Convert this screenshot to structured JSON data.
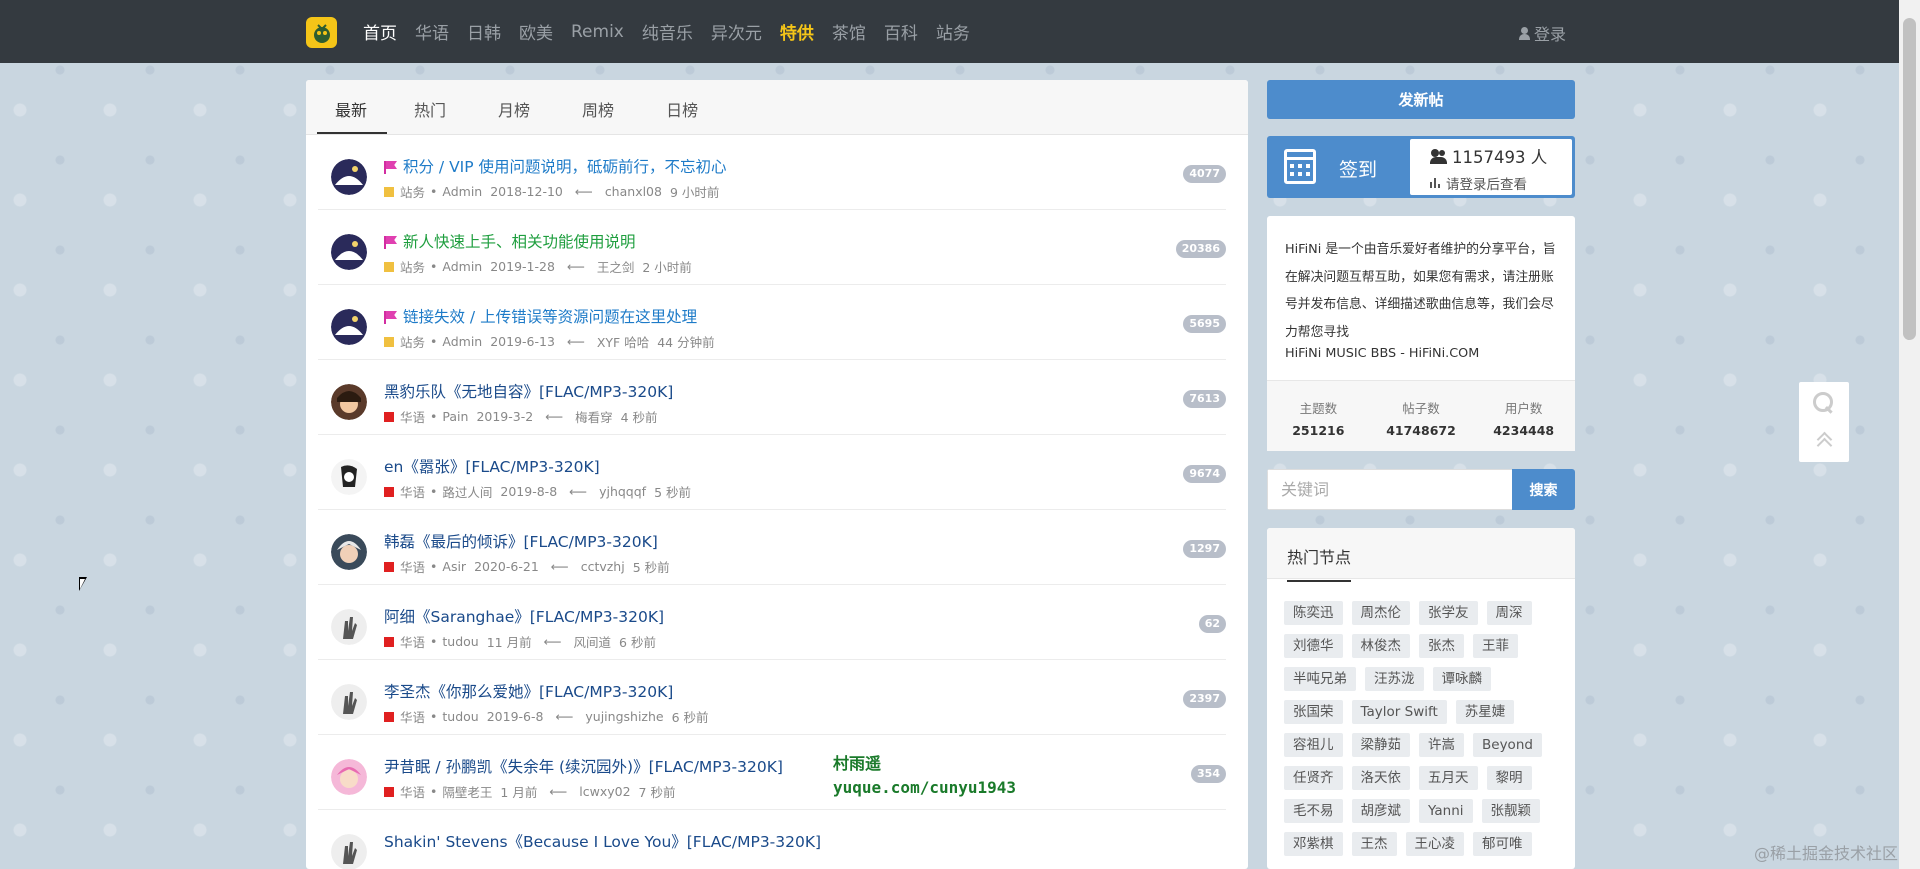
{
  "nav": {
    "logo": "logo",
    "items": [
      {
        "label": "首页",
        "state": "active"
      },
      {
        "label": "华语",
        "state": ""
      },
      {
        "label": "日韩",
        "state": ""
      },
      {
        "label": "欧美",
        "state": ""
      },
      {
        "label": "Remix",
        "state": ""
      },
      {
        "label": "纯音乐",
        "state": ""
      },
      {
        "label": "异次元",
        "state": ""
      },
      {
        "label": "特供",
        "state": "special"
      },
      {
        "label": "茶馆",
        "state": ""
      },
      {
        "label": "百科",
        "state": ""
      },
      {
        "label": "站务",
        "state": ""
      }
    ],
    "login": "登录"
  },
  "tabs": [
    "最新",
    "热门",
    "月榜",
    "周榜",
    "日榜"
  ],
  "threads": [
    {
      "title": "积分 / VIP 使用问题说明，砥砺前行，不忘初心",
      "pinned": true,
      "title_color": "blue",
      "category": "站务",
      "cat_color": "#f0c040",
      "author": "Admin",
      "date": "2018-12-10",
      "last_user": "chanxl08",
      "last_time": "9 小时前",
      "count": "4077",
      "avatar": "space"
    },
    {
      "title": "新人快速上手、相关功能使用说明",
      "pinned": true,
      "title_color": "green",
      "category": "站务",
      "cat_color": "#f0c040",
      "author": "Admin",
      "date": "2019-1-28",
      "last_user": "王之剑",
      "last_time": "2 小时前",
      "count": "20386",
      "avatar": "space"
    },
    {
      "title": "链接失效 / 上传错误等资源问题在这里处理",
      "pinned": true,
      "title_color": "blue",
      "category": "站务",
      "cat_color": "#f0c040",
      "author": "Admin",
      "date": "2019-6-13",
      "last_user": "XYF 哈哈",
      "last_time": "44 分钟前",
      "count": "5695",
      "avatar": "space"
    },
    {
      "title": "黑豹乐队《无地自容》[FLAC/MP3-320K]",
      "pinned": false,
      "title_color": "normal",
      "category": "华语",
      "cat_color": "#e02020",
      "author": "Pain",
      "date": "2019-3-2",
      "last_user": "梅看穿",
      "last_time": "4 秒前",
      "count": "7613",
      "avatar": "anime"
    },
    {
      "title": "en《嚣张》[FLAC/MP3-320K]",
      "pinned": false,
      "title_color": "normal",
      "category": "华语",
      "cat_color": "#e02020",
      "author": "路过人间",
      "date": "2019-8-8",
      "last_user": "yjhqqqf",
      "last_time": "5 秒前",
      "count": "9674",
      "avatar": "sketch"
    },
    {
      "title": "韩磊《最后的倾诉》[FLAC/MP3-320K]",
      "pinned": false,
      "title_color": "normal",
      "category": "华语",
      "cat_color": "#e02020",
      "author": "Asir",
      "date": "2020-6-21",
      "last_user": "cctvzhj",
      "last_time": "5 秒前",
      "count": "1297",
      "avatar": "silver"
    },
    {
      "title": "阿细《Saranghae》[FLAC/MP3-320K]",
      "pinned": false,
      "title_color": "normal",
      "category": "华语",
      "cat_color": "#e02020",
      "author": "tudou",
      "date": "11 月前",
      "last_user": "风间道",
      "last_time": "6 秒前",
      "count": "62",
      "avatar": "hand"
    },
    {
      "title": "李圣杰《你那么爱她》[FLAC/MP3-320K]",
      "pinned": false,
      "title_color": "normal",
      "category": "华语",
      "cat_color": "#e02020",
      "author": "tudou",
      "date": "2019-6-8",
      "last_user": "yujingshizhe",
      "last_time": "6 秒前",
      "count": "2397",
      "avatar": "hand"
    },
    {
      "title": "尹昔眠 / 孙鹏凯《失余年 (续沉园外)》[FLAC/MP3-320K]",
      "pinned": false,
      "title_color": "normal",
      "category": "华语",
      "cat_color": "#e02020",
      "author": "隔壁老王",
      "date": "1 月前",
      "last_user": "lcwxy02",
      "last_time": "7 秒前",
      "count": "354",
      "avatar": "pink"
    },
    {
      "title": "Shakin' Stevens《Because I Love You》[FLAC/MP3-320K]",
      "pinned": false,
      "title_color": "normal",
      "category": "",
      "cat_color": "#e02020",
      "author": "",
      "date": "",
      "last_user": "",
      "last_time": "",
      "count": "",
      "avatar": "hand"
    }
  ],
  "sidebar": {
    "post_button": "发新帖",
    "checkin_label": "签到",
    "checkin_count": "1157493 人",
    "checkin_login": "请登录后查看",
    "about_text": "HiFiNi 是一个由音乐爱好者维护的分享平台，旨在解决问题互帮互助，如果您有需求，请注册账号并发布信息、详细描述歌曲信息等，我们会尽力帮您寻找",
    "about_site": "HiFiNi MUSIC BBS - HiFiNi.COM",
    "stats": [
      {
        "label": "主题数",
        "value": "251216"
      },
      {
        "label": "帖子数",
        "value": "41748672"
      },
      {
        "label": "用户数",
        "value": "4234448"
      }
    ],
    "search_placeholder": "关键词",
    "search_button": "搜索",
    "hot_title": "热门节点",
    "hot_tags": [
      "陈奕迅",
      "周杰伦",
      "张学友",
      "周深",
      "刘德华",
      "林俊杰",
      "张杰",
      "王菲",
      "半吨兄弟",
      "汪苏泷",
      "谭咏麟",
      "张国荣",
      "Taylor Swift",
      "苏星婕",
      "容祖儿",
      "梁静茹",
      "许嵩",
      "Beyond",
      "任贤齐",
      "洛天依",
      "五月天",
      "黎明",
      "毛不易",
      "胡彦斌",
      "Yanni",
      "张靓颖",
      "邓紫棋",
      "王杰",
      "王心凌",
      "郁可唯"
    ]
  },
  "overlay": {
    "watermark_line1": "村雨遥",
    "watermark_line2": "yuque.com/cunyu1943",
    "corner": "@稀土掘金技术社区"
  }
}
